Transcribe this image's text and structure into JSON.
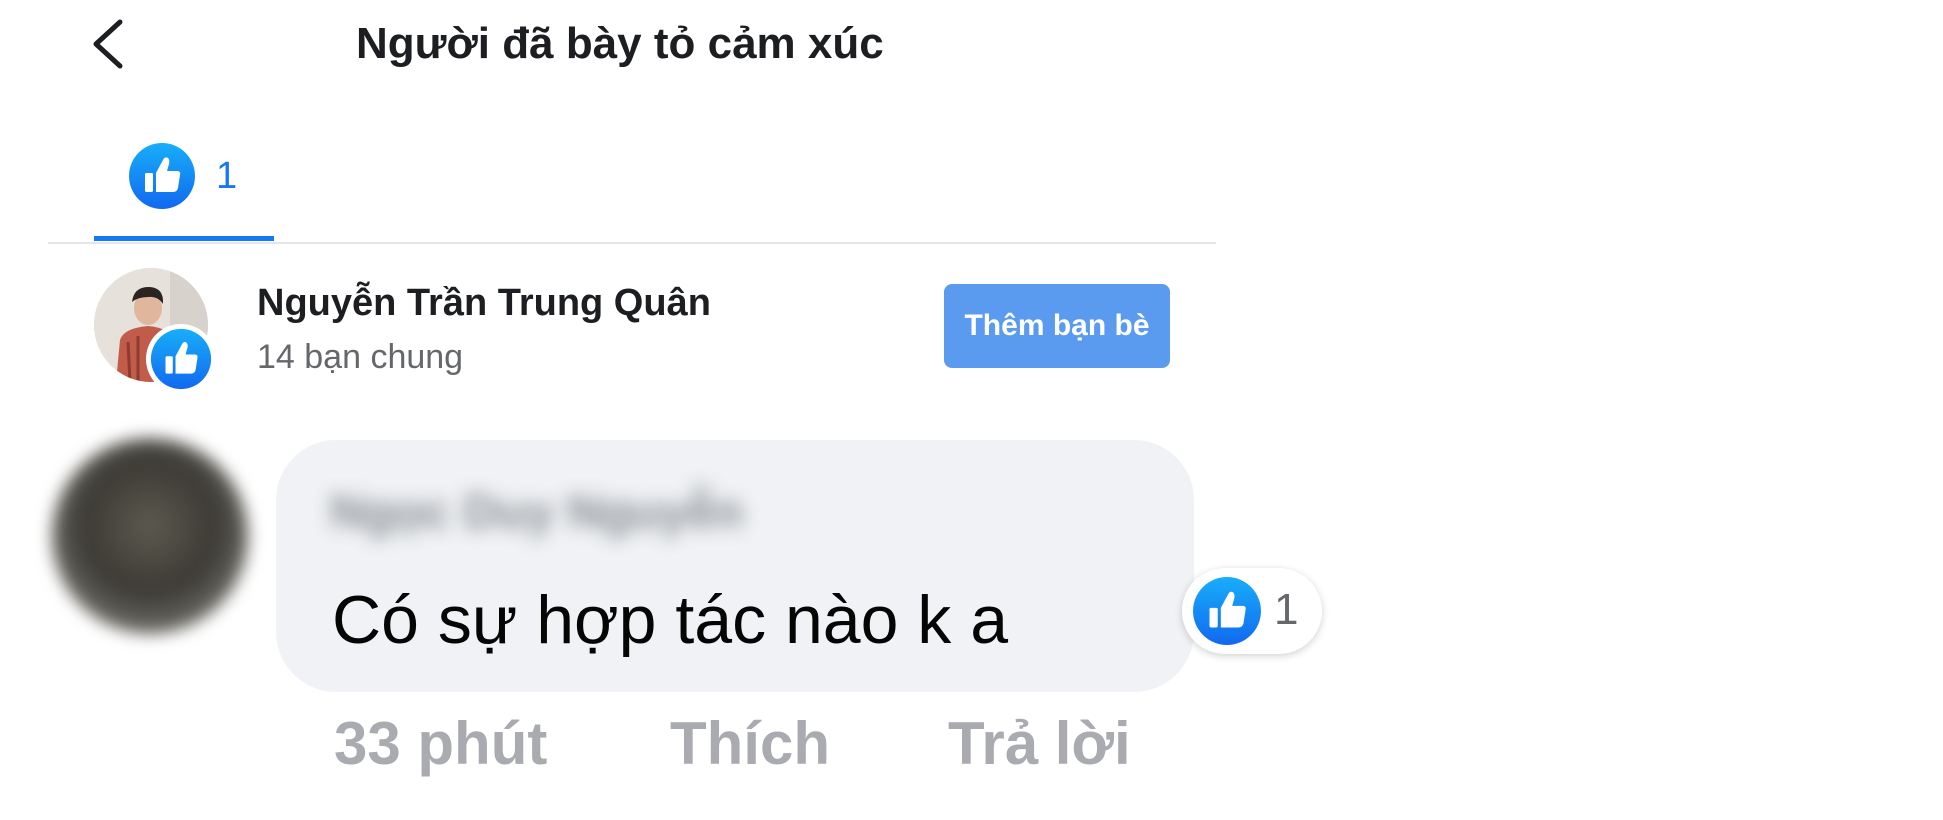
{
  "header": {
    "title": "Người đã bày tỏ cảm xúc",
    "back_icon": "chevron-left-icon"
  },
  "tabs": [
    {
      "icon": "like-icon",
      "count": "1",
      "active": true
    }
  ],
  "reactors": [
    {
      "name": "Nguyễn Trần Trung Quân",
      "mutual_friends": "14 bạn chung",
      "reaction_icon": "like-icon",
      "add_friend_label": "Thêm bạn bè"
    }
  ],
  "comment": {
    "author": "Ngọc Duy Nguyễn",
    "text": "Có sự hợp tác nào k a",
    "reaction_icon": "like-icon",
    "reaction_count": "1",
    "time": "33 phút",
    "like_label": "Thích",
    "reply_label": "Trả lời"
  },
  "colors": {
    "accent": "#1877f2",
    "button_bg": "#5a9bf0",
    "bubble_bg": "#f0f2f5",
    "muted_text": "#65676b",
    "action_text": "#a9abb0"
  }
}
